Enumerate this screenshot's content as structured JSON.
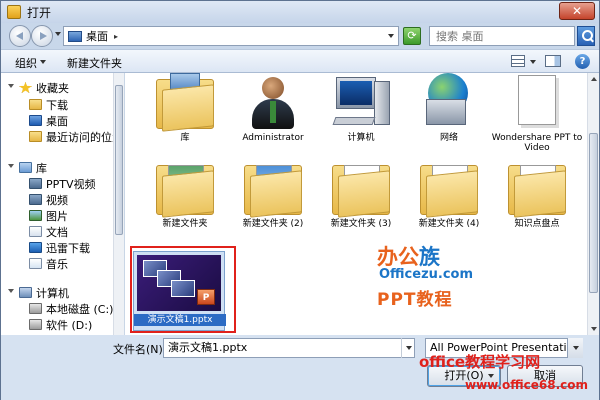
{
  "window": {
    "title": "打开",
    "close_glyph": "✕"
  },
  "address": {
    "location": "桌面",
    "separator": "▸",
    "search_placeholder": "搜索 桌面",
    "refresh_glyph": "⟳"
  },
  "toolbar": {
    "organize": "组织",
    "new_folder": "新建文件夹",
    "help": "?"
  },
  "sidebar": {
    "items": [
      {
        "label": "收藏夹",
        "icon": "star-icon"
      },
      {
        "label": "下载",
        "icon": "folder-icon"
      },
      {
        "label": "桌面",
        "icon": "desktop-icon"
      },
      {
        "label": "最近访问的位置",
        "icon": "recent-places-icon"
      },
      {
        "label": "库",
        "icon": "library-icon"
      },
      {
        "label": "PPTV视频",
        "icon": "video-icon"
      },
      {
        "label": "视频",
        "icon": "video-icon"
      },
      {
        "label": "图片",
        "icon": "picture-icon"
      },
      {
        "label": "文档",
        "icon": "document-icon"
      },
      {
        "label": "迅雷下载",
        "icon": "xunlei-icon"
      },
      {
        "label": "音乐",
        "icon": "music-icon"
      },
      {
        "label": "计算机",
        "icon": "computer-icon"
      },
      {
        "label": "本地磁盘 (C:)",
        "icon": "disk-icon"
      },
      {
        "label": "软件 (D:)",
        "icon": "disk-icon"
      }
    ]
  },
  "files": [
    {
      "label": "库",
      "icon": "library-icon"
    },
    {
      "label": "Administrator",
      "icon": "user-icon"
    },
    {
      "label": "计算机",
      "icon": "computer-icon"
    },
    {
      "label": "网络",
      "icon": "network-icon"
    },
    {
      "label": "Wondershare PPT to Video",
      "icon": "document-icon"
    },
    {
      "label": "新建文件夹",
      "icon": "folder-icon"
    },
    {
      "label": "新建文件夹 (2)",
      "icon": "folder-icon"
    },
    {
      "label": "新建文件夹 (3)",
      "icon": "folder-icon"
    },
    {
      "label": "新建文件夹 (4)",
      "icon": "folder-icon"
    },
    {
      "label": "知识点盘点",
      "icon": "folder-icon"
    },
    {
      "label": "演示文稿1.pptx",
      "icon": "pptx-thumbnail",
      "selected": true
    }
  ],
  "watermarks": {
    "logo_a": "办公",
    "logo_b": "族",
    "site": "Officezu.com",
    "ppt": "PPT教程",
    "bottom1": "office教程学习网",
    "bottom2": "www.office68.com"
  },
  "bottom": {
    "filename_label": "文件名(N):",
    "filename_value": "演示文稿1.pptx",
    "filter_value": "All PowerPoint Presentations",
    "open_button": "打开(O)",
    "cancel_button": "取消"
  },
  "colors": {
    "highlight_red": "#e0211b",
    "watermark_orange": "#e8621d",
    "watermark_blue": "#1b75c7"
  }
}
